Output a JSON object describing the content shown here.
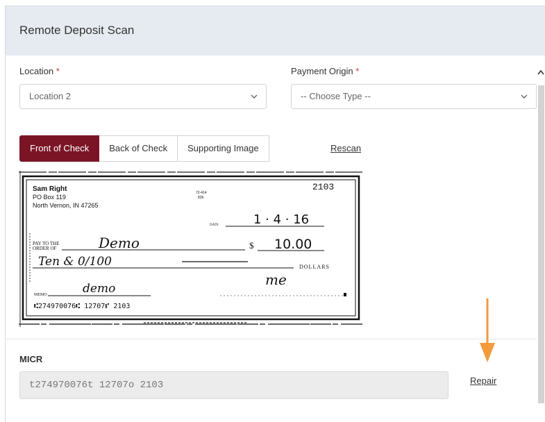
{
  "header": {
    "title": "Remote Deposit Scan"
  },
  "form": {
    "location": {
      "label": "Location",
      "value": "Location 2"
    },
    "payment_origin": {
      "label": "Payment Origin",
      "placeholder": "-- Choose Type --"
    },
    "required_mark": "*"
  },
  "tabs": [
    {
      "label": "Front of Check",
      "active": true
    },
    {
      "label": "Back of Check",
      "active": false
    },
    {
      "label": "Supporting Image",
      "active": false
    }
  ],
  "rescan_label": "Rescan",
  "check": {
    "payer_name": "Sam Right",
    "payer_address1": "PO Box 119",
    "payer_address2": "North Vernon, IN 47265",
    "check_number": "2103",
    "fraction": "72-414",
    "fraction2": "839",
    "date_label": "DATE",
    "date_value": "1 · 4 · 16",
    "pay_to_label1": "PAY TO THE",
    "pay_to_label2": "ORDER OF",
    "payee": "Demo",
    "currency": "$",
    "amount": "10.00",
    "written_amount": "Ten & 0/100",
    "dollars_label": "DOLLARS",
    "memo_label": "MEMO",
    "memo": "demo",
    "signature": "me",
    "micr_line": "⑆274970076⑆   12707⑈     2103"
  },
  "micr": {
    "label": "MICR",
    "value": "t274970076t 12707o 2103"
  },
  "repair_label": "Repair",
  "colors": {
    "accent": "#7b1526",
    "arrow": "#f39a3b",
    "header_bg": "#e6ebf1"
  }
}
